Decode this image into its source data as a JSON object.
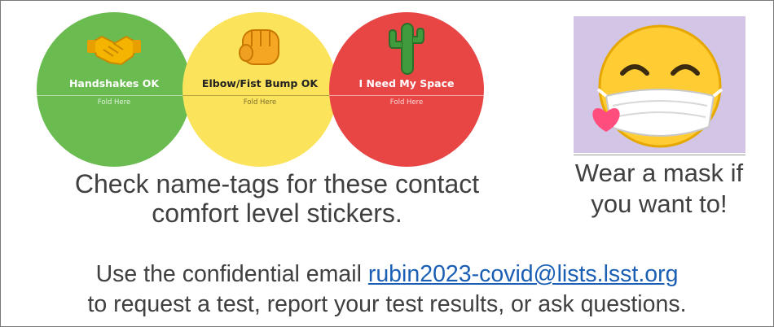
{
  "stickers": [
    {
      "label": "Handshakes OK",
      "fold": "Fold Here",
      "color": "#6abb50",
      "icon": "handshake-icon"
    },
    {
      "label": "Elbow/Fist Bump OK",
      "fold": "Fold Here",
      "color": "#fbe35c",
      "icon": "fist-bump-icon"
    },
    {
      "label": "I Need My Space",
      "fold": "Fold Here",
      "color": "#e84545",
      "icon": "cactus-icon"
    }
  ],
  "mask": {
    "icon": "mask-emoji-icon",
    "background": "#d2c5e6"
  },
  "captions": {
    "stickers_line1": "Check name-tags for these contact",
    "stickers_line2": "comfort level stickers.",
    "mask_line1": "Wear a mask if",
    "mask_line2": "you want to!"
  },
  "footer": {
    "prefix": "Use the confidential email",
    "email": "rubin2023-covid@lists.lsst.org",
    "line2": "to request a test, report your test results, or ask questions."
  }
}
